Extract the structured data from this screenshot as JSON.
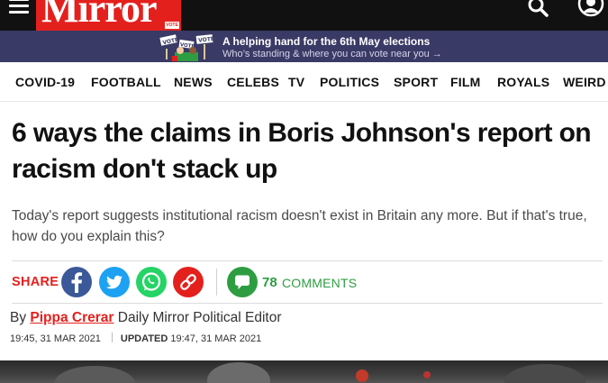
{
  "header": {
    "logo_text": "Mirror",
    "logo_vote_tag": "VOTE"
  },
  "banner": {
    "sign_labels": [
      "VOTE",
      "VOTE",
      "VOTE"
    ],
    "title": "A helping hand for the 6th May elections",
    "subtitle": "Who’s standing & where you can vote near you →"
  },
  "nav": {
    "items": [
      "COVID-19",
      "FOOTBALL",
      "NEWS",
      "CELEBS",
      "TV",
      "POLITICS",
      "SPORT",
      "FILM",
      "ROYALS",
      "WEIRD"
    ]
  },
  "article": {
    "headline": "6 ways the claims in Boris Johnson's report on racism don't stack up",
    "standfirst": "Today's report suggests institutional racism doesn't exist in Britain any more. But if that's true, how do you explain this?",
    "share_label": "SHARE",
    "comments_count": "78",
    "comments_label": "COMMENTS",
    "byline_prefix": "By",
    "author": "Pippa Crerar",
    "author_role": "Daily Mirror Political Editor",
    "published": "19:45, 31 MAR 2021",
    "updated_label": "UPDATED",
    "updated": "19:47, 31 MAR 2021"
  },
  "colors": {
    "brand_red": "#e4201d",
    "banner_bg": "#3a3a66",
    "facebook": "#3b5998",
    "twitter": "#1da1f2",
    "whatsapp": "#25d366",
    "link": "#e4201d",
    "comments_green": "#2e9d41"
  },
  "icons": [
    "menu-icon",
    "search-icon",
    "account-icon",
    "facebook-icon",
    "twitter-icon",
    "whatsapp-icon",
    "link-icon",
    "comment-bubble-icon"
  ]
}
